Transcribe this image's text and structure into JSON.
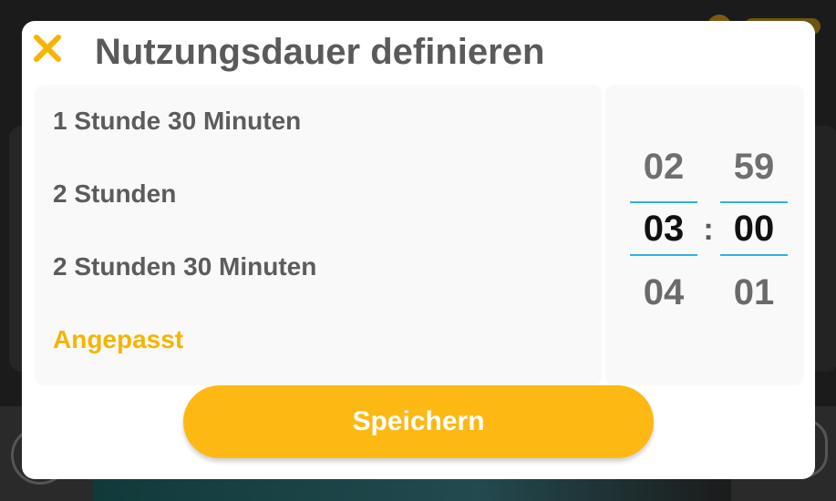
{
  "dialog": {
    "title": "Nutzungsdauer definieren",
    "close_icon": "close-icon",
    "accent_color": "#f5b400",
    "options": [
      {
        "label": "1 Stunde 30 Minuten",
        "selected": false
      },
      {
        "label": "2 Stunden",
        "selected": false
      },
      {
        "label": "2 Stunden 30 Minuten",
        "selected": false
      },
      {
        "label": "Angepasst",
        "selected": true
      }
    ],
    "time_picker": {
      "hours": {
        "previous": "02",
        "current": "03",
        "next": "04"
      },
      "separator": ":",
      "minutes": {
        "previous": "59",
        "current": "00",
        "next": "01"
      },
      "indicator_color": "#2ab3e6"
    },
    "save_button": {
      "label": "Speichern",
      "color": "#fdb813"
    }
  }
}
